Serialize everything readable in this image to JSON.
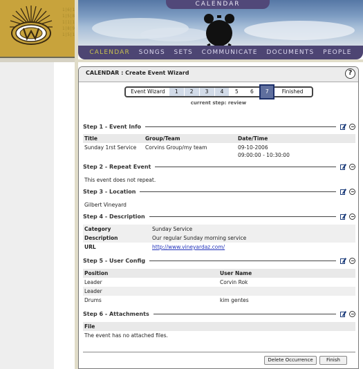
{
  "header": {
    "calendar_tab": "CALENDAR",
    "logo_numbers": [
      "1|6|1",
      "1|5|8",
      "1|1|1",
      "1|8|9",
      "1|5|1"
    ]
  },
  "nav": {
    "items": [
      "CALENDAR",
      "SONGS",
      "SETS",
      "COMMUNICATE",
      "DOCUMENTS",
      "PEOPLE"
    ],
    "active": "CALENDAR"
  },
  "panel": {
    "title": "CALENDAR : Create Event Wizard",
    "help": "?",
    "wizard": {
      "label": "Event Wizard",
      "steps": [
        "1",
        "2",
        "3",
        "4",
        "5",
        "6",
        "7"
      ],
      "finished": "Finished",
      "current": "7",
      "current_step_text": "current step: review"
    }
  },
  "step1": {
    "title": "Step 1 - Event Info",
    "headers": [
      "Title",
      "Group/Team",
      "Date/Time"
    ],
    "row": {
      "title": "Sunday 1rst Service",
      "group": "Corvins Group/my team",
      "date": "09-10-2006",
      "time": "09:00:00 - 10:30:00"
    }
  },
  "step2": {
    "title": "Step 2 - Repeat Event",
    "text": "This event does not repeat."
  },
  "step3": {
    "title": "Step 3 - Location",
    "text": "Gilbert Vineyard"
  },
  "step4": {
    "title": "Step 4 - Description",
    "rows": [
      {
        "label": "Category",
        "value": "Sunday Service"
      },
      {
        "label": "Description",
        "value": "Our regular Sunday morning service"
      },
      {
        "label": "URL",
        "value": "http://www.vineyardaz.com/"
      }
    ]
  },
  "step5": {
    "title": "Step 5 - User Config",
    "headers": [
      "Position",
      "User Name"
    ],
    "rows": [
      {
        "position": "Leader",
        "user": "Corvin Rok"
      },
      {
        "position": "Leader",
        "user": ""
      },
      {
        "position": "Drums",
        "user": "kim gentes"
      }
    ]
  },
  "step6": {
    "title": "Step 6 - Attachments",
    "header": "File",
    "text": "The event has no attached files."
  },
  "buttons": {
    "delete": "Delete Occurrence",
    "finish": "Finish"
  },
  "colors": {
    "nav_bg": "#4d4573",
    "active_nav": "#c8c050",
    "logo_gold": "#c8a33c",
    "current_step": "#5f6f9e"
  }
}
